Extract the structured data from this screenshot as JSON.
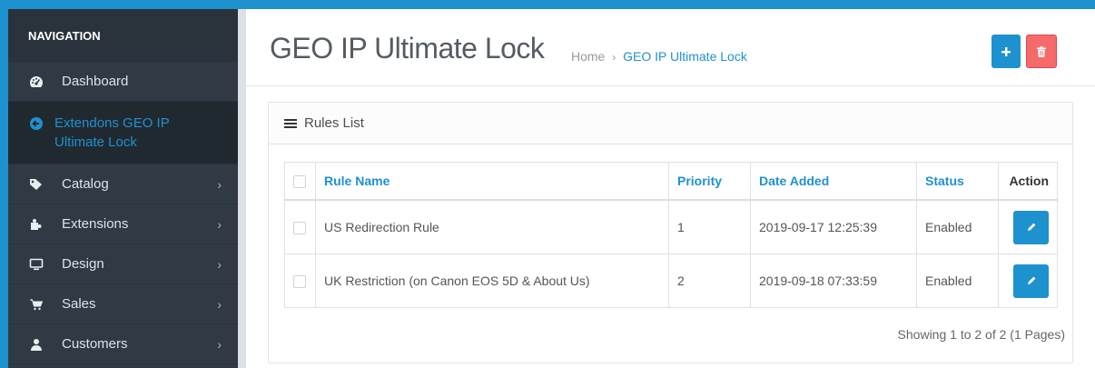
{
  "sidebar": {
    "heading": "NAVIGATION",
    "items": [
      {
        "label": "Dashboard",
        "icon": "dashboard-icon",
        "chevron": false
      },
      {
        "label": "Extendons GEO IP Ultimate Lock",
        "icon": "circle-arrow-icon",
        "chevron": false,
        "active": true
      },
      {
        "label": "Catalog",
        "icon": "tags-icon",
        "chevron": true
      },
      {
        "label": "Extensions",
        "icon": "puzzle-icon",
        "chevron": true
      },
      {
        "label": "Design",
        "icon": "desktop-icon",
        "chevron": true
      },
      {
        "label": "Sales",
        "icon": "shopping-cart-icon",
        "chevron": true
      },
      {
        "label": "Customers",
        "icon": "user-icon",
        "chevron": true
      }
    ]
  },
  "header": {
    "title": "GEO IP Ultimate Lock",
    "breadcrumb": [
      "Home",
      "GEO IP Ultimate Lock"
    ],
    "breadcrumb_separator": "›"
  },
  "panel": {
    "title": "Rules List",
    "columns": [
      "Rule Name",
      "Priority",
      "Date Added",
      "Status",
      "Action"
    ],
    "rows": [
      {
        "rule_name": "US Redirection Rule",
        "priority": "1",
        "date_added": "2019-09-17 12:25:39",
        "status": "Enabled"
      },
      {
        "rule_name": "UK Restriction (on Canon EOS 5D & About Us)",
        "priority": "2",
        "date_added": "2019-09-18 07:33:59",
        "status": "Enabled"
      }
    ],
    "pagination_text": "Showing 1 to 2 of 2 (1 Pages)"
  },
  "colors": {
    "accent": "#1e91cf",
    "danger": "#f56b6b",
    "sidebar_bg": "#2f3a45"
  }
}
